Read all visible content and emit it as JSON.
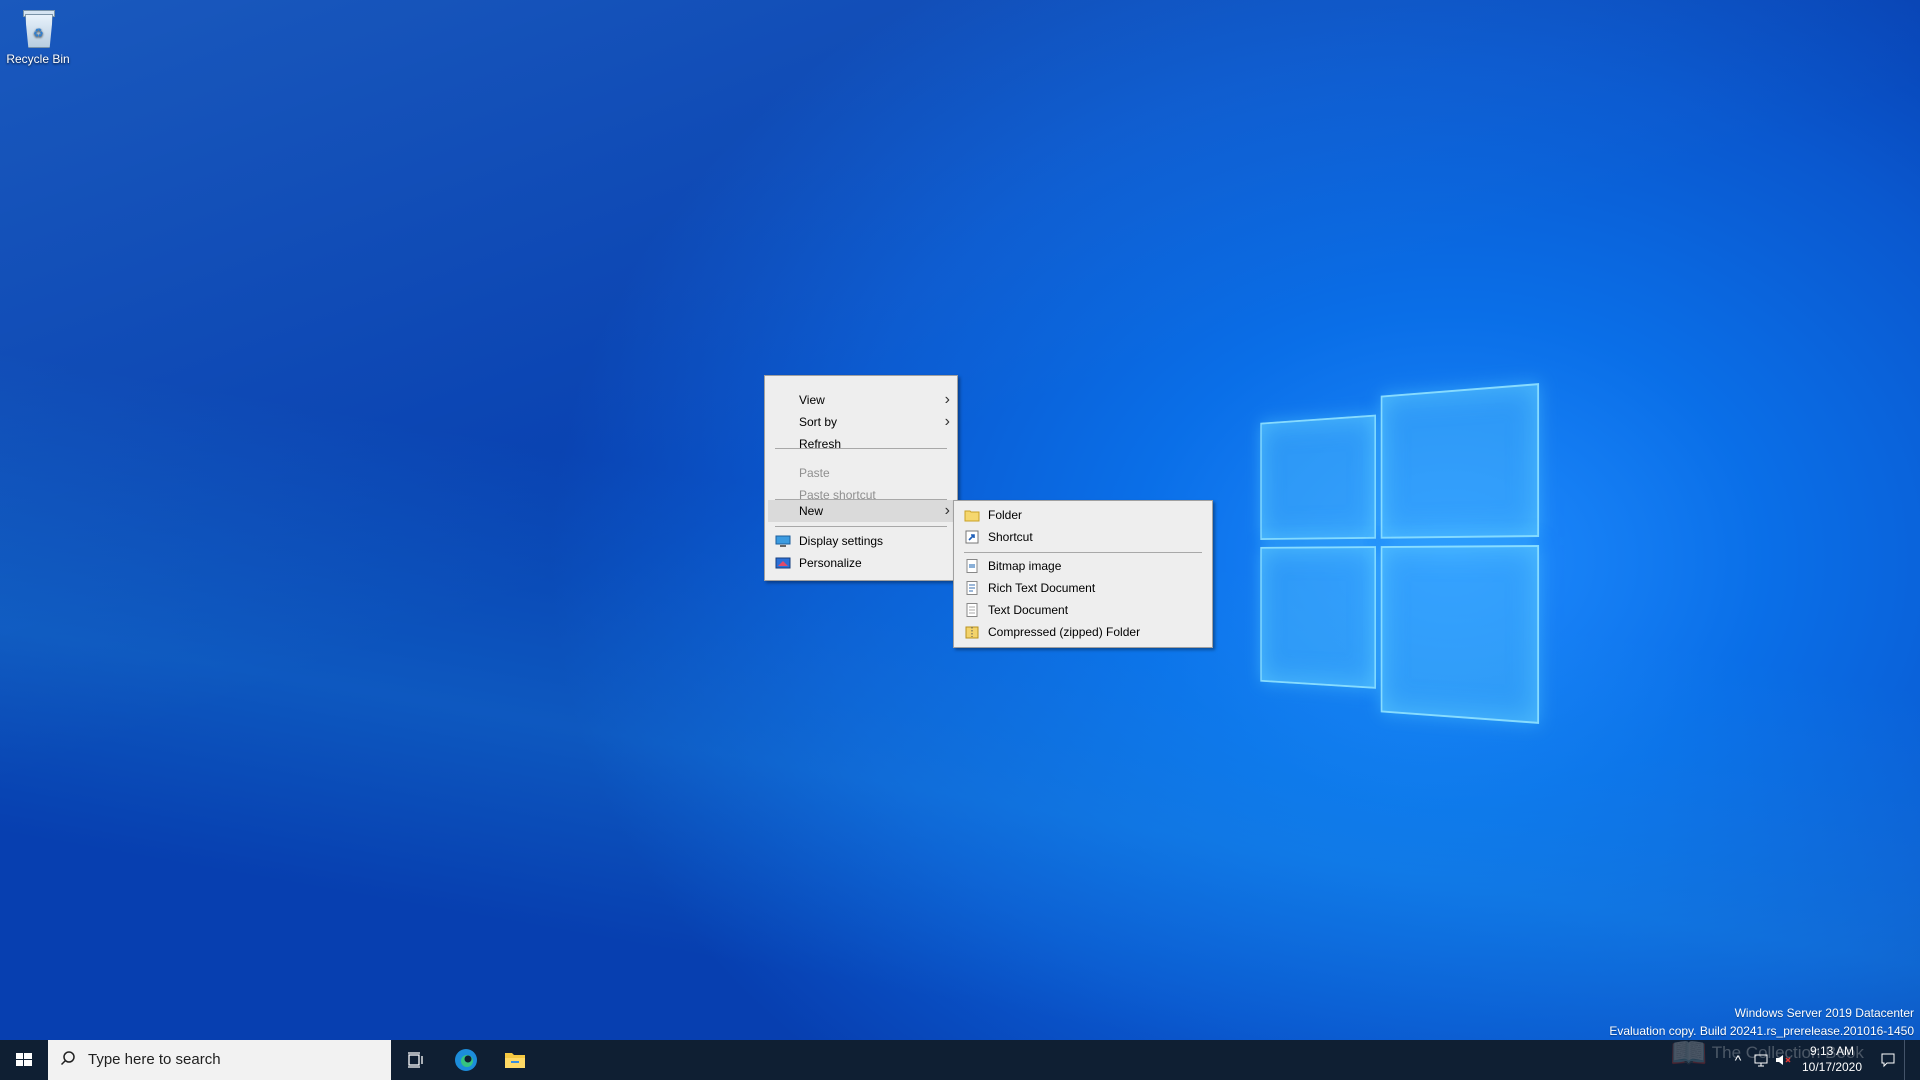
{
  "desktop": {
    "icons": [
      {
        "label": "Recycle Bin",
        "icon": "recycle-bin-icon"
      }
    ]
  },
  "context_menu": {
    "items": [
      {
        "label": "View",
        "has_submenu": true
      },
      {
        "label": "Sort by",
        "has_submenu": true
      },
      {
        "label": "Refresh"
      },
      {
        "label": "Paste",
        "disabled": true
      },
      {
        "label": "Paste shortcut",
        "disabled": true
      },
      {
        "label": "New",
        "has_submenu": true,
        "highlighted": true
      },
      {
        "label": "Display settings",
        "icon": "display-icon"
      },
      {
        "label": "Personalize",
        "icon": "personalize-icon"
      }
    ]
  },
  "new_submenu": {
    "items": [
      {
        "label": "Folder",
        "icon": "folder-icon"
      },
      {
        "label": "Shortcut",
        "icon": "shortcut-icon"
      },
      {
        "label": "Bitmap image",
        "icon": "bitmap-icon"
      },
      {
        "label": "Rich Text Document",
        "icon": "rtf-icon"
      },
      {
        "label": "Text Document",
        "icon": "text-doc-icon"
      },
      {
        "label": "Compressed (zipped) Folder",
        "icon": "zip-folder-icon"
      }
    ]
  },
  "taskbar": {
    "search_placeholder": "Type here to search",
    "pinned": [
      "task-view-icon",
      "edge-icon",
      "file-explorer-icon"
    ],
    "clock_time": "9:13 AM",
    "clock_date": "10/17/2020"
  },
  "watermark": {
    "line1": "Windows Server 2019 Datacenter",
    "line2": "Evaluation copy. Build 20241.rs_prerelease.201016-1450",
    "overlay": "The Collection Book"
  },
  "colors": {
    "desktop_accent": "#0a6fe8",
    "taskbar": "#0f1f33",
    "menu_bg": "#eeeeee",
    "menu_highlight": "#dadada"
  }
}
